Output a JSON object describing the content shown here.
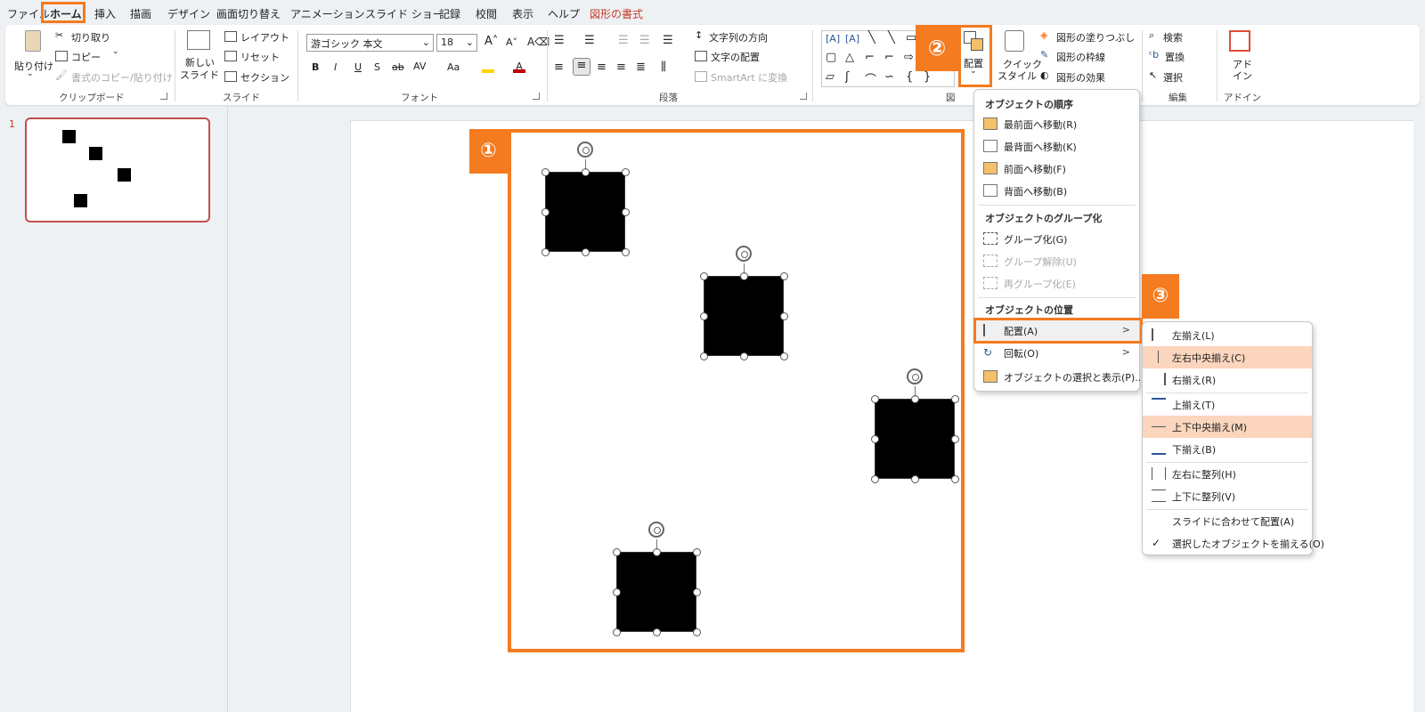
{
  "menubar": {
    "tabs": [
      "ファイル",
      "ホーム",
      "挿入",
      "描画",
      "デザイン",
      "画面切り替え",
      "アニメーション",
      "スライド ショー",
      "記録",
      "校閲",
      "表示",
      "ヘルプ",
      "図形の書式"
    ]
  },
  "ribbon": {
    "clipboard": {
      "paste": "貼り付け",
      "cut": "切り取り",
      "copy": "コピー",
      "format_painter": "書式のコピー/貼り付け",
      "label": "クリップボード"
    },
    "slides": {
      "new_slide_line1": "新しい",
      "new_slide_line2": "スライド",
      "layout": "レイアウト",
      "reset": "リセット",
      "section": "セクション",
      "label": "スライド"
    },
    "font": {
      "font_name": "游ゴシック 本文",
      "font_size": "18",
      "bold": "B",
      "italic": "I",
      "underline": "U",
      "shadow": "S",
      "strike": "ab",
      "spacing": "AV",
      "case": "Aa",
      "label": "フォント"
    },
    "paragraph": {
      "text_direction": "文字列の方向",
      "align_text": "文字の配置",
      "smartart": "SmartArt に変換",
      "label": "段落"
    },
    "drawing": {
      "arrange_line1": "配置",
      "quick_styles_line1": "クイック",
      "quick_styles_line2": "スタイル",
      "shape_fill": "図形の塗りつぶし",
      "shape_outline": "図形の枠線",
      "shape_effects": "図形の効果",
      "label": "図"
    },
    "editing": {
      "find": "検索",
      "replace": "置換",
      "select": "選択",
      "label": "編集"
    },
    "addins": {
      "line1": "アド",
      "line2": "イン",
      "label": "アドイン"
    }
  },
  "thumbnail": {
    "number": "1"
  },
  "badges": {
    "one": "①",
    "two": "②",
    "three": "③"
  },
  "arrange_menu": {
    "order_header": "オブジェクトの順序",
    "bring_front": "最前面へ移動(R)",
    "send_back": "最背面へ移動(K)",
    "bring_forward": "前面へ移動(F)",
    "send_backward": "背面へ移動(B)",
    "group_header": "オブジェクトのグループ化",
    "group": "グループ化(G)",
    "ungroup": "グループ解除(U)",
    "regroup": "再グループ化(E)",
    "position_header": "オブジェクトの位置",
    "align": "配置(A)",
    "rotate": "回転(O)",
    "selection_pane": "オブジェクトの選択と表示(P)..."
  },
  "align_menu": {
    "left": "左揃え(L)",
    "center": "左右中央揃え(C)",
    "right": "右揃え(R)",
    "top": "上揃え(T)",
    "middle": "上下中央揃え(M)",
    "bottom": "下揃え(B)",
    "dist_h": "左右に整列(H)",
    "dist_v": "上下に整列(V)",
    "to_slide": "スライドに合わせて配置(A)",
    "to_selected": "選択したオブジェクトを揃える(O)"
  },
  "colors": {
    "accent": "#f47b20",
    "highlight": "#fbd5bd",
    "shape_format": "#c33b2a"
  }
}
